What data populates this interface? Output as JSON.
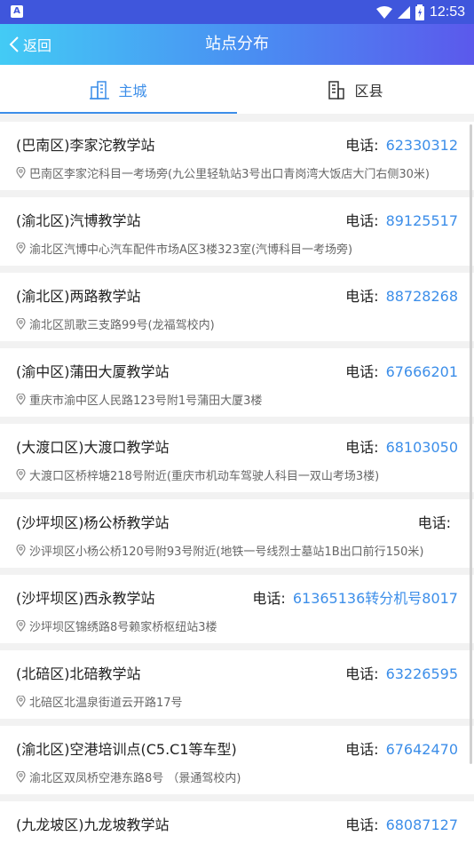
{
  "status": {
    "time": "12:53",
    "app_badge": "A"
  },
  "nav": {
    "back_label": "返回",
    "title": "站点分布"
  },
  "tabs": [
    {
      "label": "主城",
      "icon": "city-building-icon",
      "active": true
    },
    {
      "label": "区县",
      "icon": "county-building-icon",
      "active": false
    }
  ],
  "phone_label": "电话:",
  "stations": [
    {
      "name": "(巴南区)李家沱教学站",
      "phone": "62330312",
      "address": "巴南区李家沱科目一考场旁(九公里轻轨站3号出口青岗湾大饭店大门右侧30米)"
    },
    {
      "name": "(渝北区)汽博教学站",
      "phone": "89125517",
      "address": "渝北区汽博中心汽车配件市场A区3楼323室(汽博科目一考场旁)"
    },
    {
      "name": "(渝北区)两路教学站",
      "phone": "88728268",
      "address": "渝北区凯歌三支路99号(龙福驾校内)"
    },
    {
      "name": "(渝中区)蒲田大厦教学站",
      "phone": "67666201",
      "address": "重庆市渝中区人民路123号附1号蒲田大厦3楼"
    },
    {
      "name": "(大渡口区)大渡口教学站",
      "phone": "68103050",
      "address": "大渡口区桥梓塘218号附近(重庆市机动车驾驶人科目一双山考场3楼)"
    },
    {
      "name": "(沙坪坝区)杨公桥教学站",
      "phone": "",
      "address": "沙评坝区小杨公桥120号附93号附近(地铁一号线烈士墓站1B出口前行150米)"
    },
    {
      "name": "(沙坪坝区)西永教学站",
      "phone": "61365136转分机号8017",
      "address": "沙坪坝区锦绣路8号赖家桥枢纽站3楼"
    },
    {
      "name": "(北碚区)北碚教学站",
      "phone": "63226595",
      "address": "北碚区北温泉街道云开路17号"
    },
    {
      "name": "(渝北区)空港培训点(C5.C1等车型)",
      "phone": "67642470",
      "address": "渝北区双凤桥空港东路8号 （景通驾校内)"
    },
    {
      "name": "(九龙坡区)九龙坡教学站",
      "phone": "68087127",
      "address": ""
    }
  ]
}
